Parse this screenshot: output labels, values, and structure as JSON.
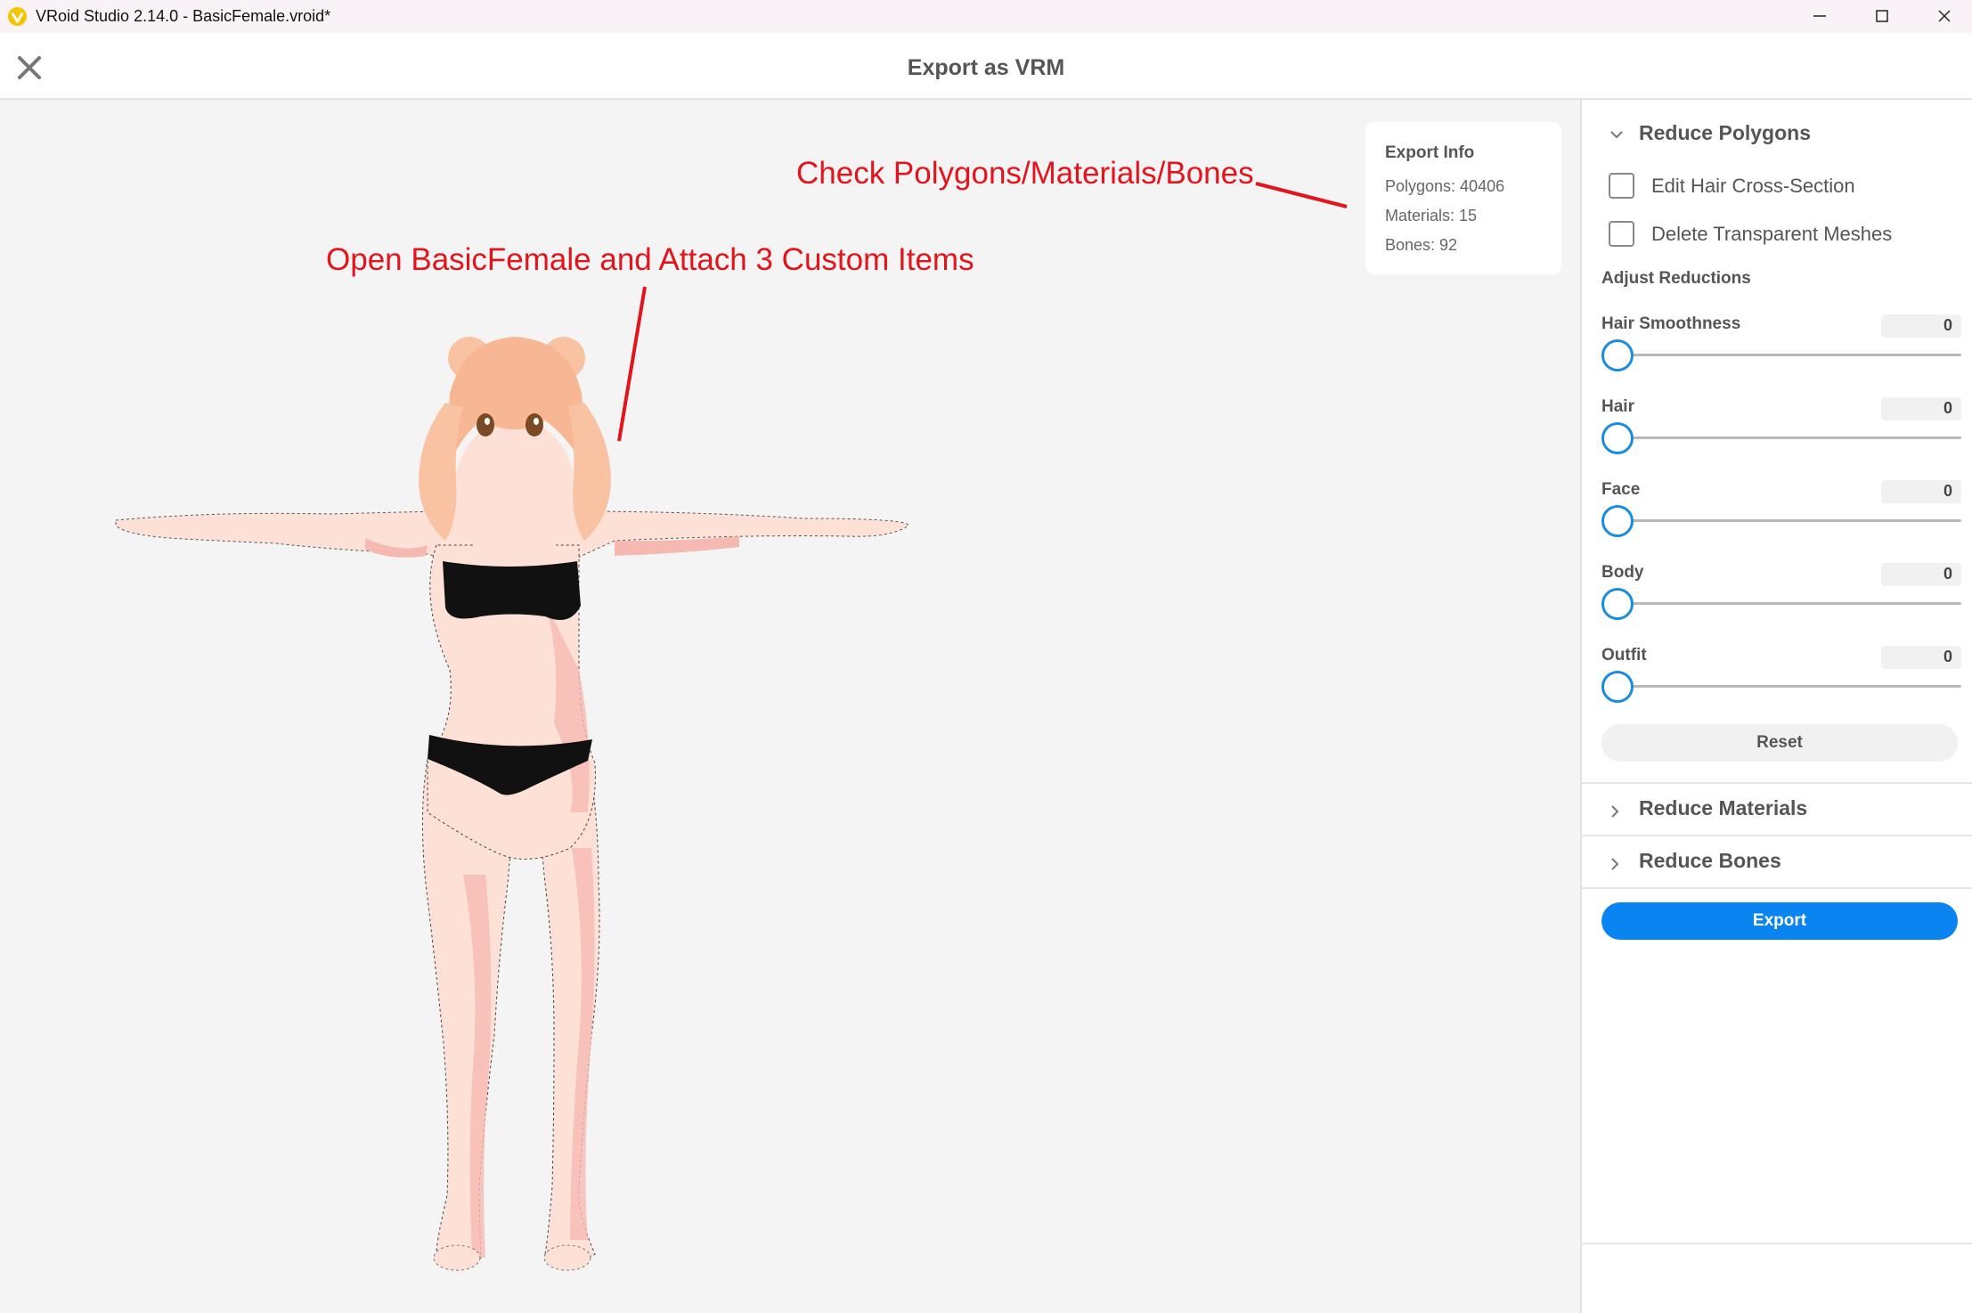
{
  "window": {
    "title": "VRoid Studio 2.14.0 - BasicFemale.vroid*",
    "logo_icon": "vroid-logo-icon",
    "controls": [
      "minimize-icon",
      "maximize-icon",
      "close-icon"
    ]
  },
  "header": {
    "title": "Export as VRM",
    "close_icon": "close-icon"
  },
  "viewport": {
    "annotations": [
      "Open BasicFemale and Attach 3 Custom Items",
      "Check Polygons/Materials/Bones"
    ],
    "annotation_color": "#e3141b"
  },
  "export_info": {
    "title": "Export Info",
    "polygons": "Polygons: 40406",
    "materials": "Materials: 15",
    "bones": "Bones: 92"
  },
  "panel": {
    "reduce_polygons": {
      "label": "Reduce Polygons",
      "expanded": true,
      "checkboxes": [
        {
          "label": "Edit Hair Cross-Section",
          "checked": false
        },
        {
          "label": "Delete Transparent Meshes",
          "checked": false
        }
      ],
      "adjust_label": "Adjust Reductions",
      "sliders": [
        {
          "label": "Hair Smoothness",
          "value": "0"
        },
        {
          "label": "Hair",
          "value": "0"
        },
        {
          "label": "Face",
          "value": "0"
        },
        {
          "label": "Body",
          "value": "0"
        },
        {
          "label": "Outfit",
          "value": "0"
        }
      ],
      "reset_label": "Reset"
    },
    "reduce_materials": {
      "label": "Reduce Materials",
      "expanded": false
    },
    "reduce_bones": {
      "label": "Reduce Bones",
      "expanded": false
    },
    "export_label": "Export",
    "accent_color": "#0a84f0"
  }
}
